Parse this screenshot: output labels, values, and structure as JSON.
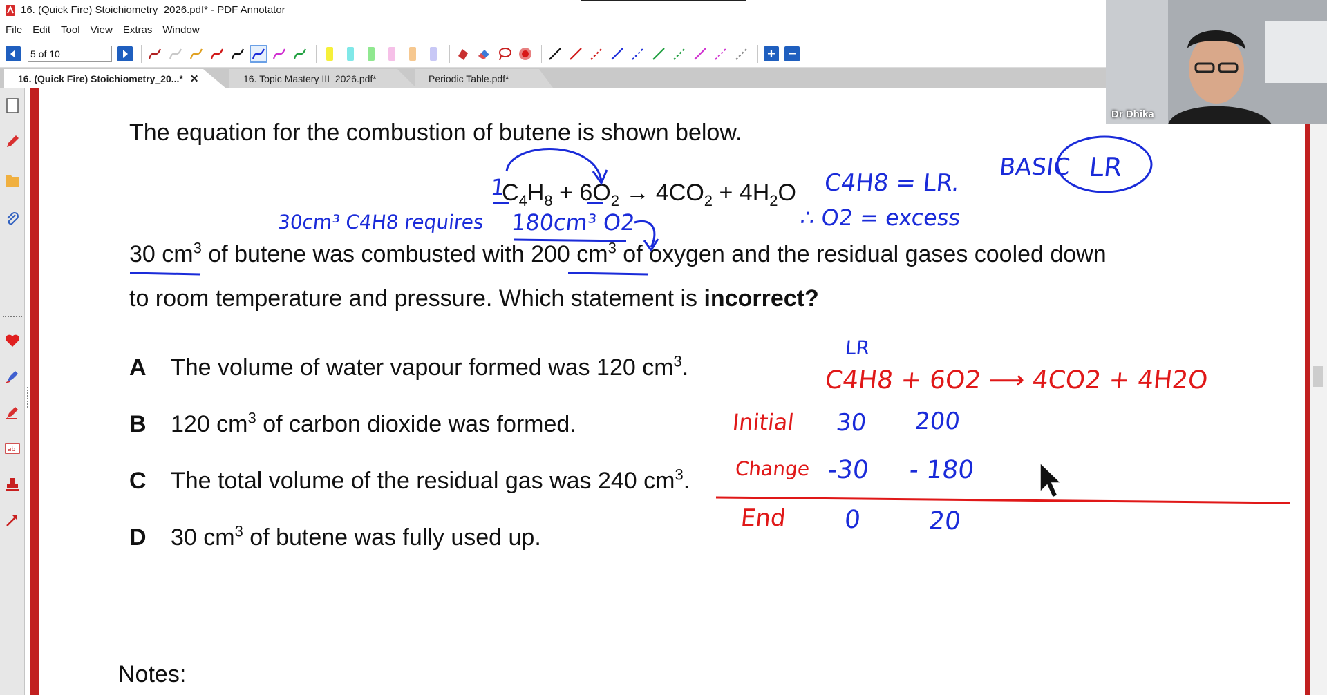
{
  "window": {
    "title": "16. (Quick Fire) Stoichiometry_2026.pdf* - PDF Annotator"
  },
  "menu": [
    "File",
    "Edit",
    "Tool",
    "View",
    "Extras",
    "Window"
  ],
  "toolbar": {
    "page_value": "5 of 10",
    "pen_colors": [
      "#b02020",
      "#c8c8c8",
      "#e0a020",
      "#d01818",
      "#111111",
      "#1a2bd9",
      "#d030d0",
      "#20a040"
    ],
    "highlighter_colors": [
      "#f6f03a",
      "#80e8e8",
      "#90e890",
      "#f6c0e8",
      "#f6c890",
      "#c8c8f6"
    ],
    "line_colors": [
      "#111111",
      "#d01818",
      "#d01818",
      "#1a2bd9",
      "#1a2bd9",
      "#20a040",
      "#20a040",
      "#d030d0",
      "#d030d0",
      "#888888"
    ]
  },
  "tabs": [
    {
      "label": "16. (Quick Fire) Stoichiometry_20...*",
      "active": true,
      "close": "✕"
    },
    {
      "label": "16. Topic Mastery III_2026.pdf*",
      "active": false
    },
    {
      "label": "Periodic Table.pdf*",
      "active": false
    }
  ],
  "document": {
    "intro": "The equation for the combustion of butene is shown below.",
    "equation": {
      "reactant1": "C",
      "s4": "4",
      "h": "H",
      "s8": "8",
      "plus1": " + 6O",
      "s2a": "2",
      "arrow": " → 4CO",
      "s2b": "2",
      "plus2": " + 4H",
      "s2c": "2",
      "o": "O"
    },
    "body1": {
      "a": "30 cm",
      "sup": "3",
      "b": " of butene was combusted with 200 cm",
      "sup2": "3",
      "c": " of oxygen and the residual gases cooled down"
    },
    "body2": {
      "a": "to room temperature and pressure. Which statement is ",
      "bold": "incorrect?"
    },
    "options": [
      {
        "letter": "A",
        "text": "The volume of water vapour formed was 120 cm",
        "sup": "3",
        "end": "."
      },
      {
        "letter": "B",
        "text": "120 cm",
        "sup": "3",
        "end": " of carbon dioxide was formed."
      },
      {
        "letter": "C",
        "text": "The total volume of the residual gas was 240 cm",
        "sup": "3",
        "end": "."
      },
      {
        "letter": "D",
        "text": "30 cm",
        "sup": "3",
        "end": " of butene was fully used up."
      }
    ],
    "notes": "Notes:"
  },
  "annotations": {
    "one": "1",
    "requires": "30cm³ C4H8  requires",
    "o2_needed": "180cm³ O2",
    "lr_line": "C4H8 = LR.",
    "excess_line": "∴ O2 = excess",
    "basic": "BASIC",
    "lr_circle": "LR",
    "lr_label": "LR",
    "table_eq": "C4H8 + 6O2 ⟶ 4CO2 + 4H2O",
    "rows": [
      {
        "label": "Initial",
        "c4h8": "30",
        "o2": "200"
      },
      {
        "label": "Change",
        "c4h8": "-30",
        "o2": "- 180"
      },
      {
        "label": "End",
        "c4h8": "0",
        "o2": "20"
      }
    ]
  },
  "webcam": {
    "name": "Dr Dhika"
  }
}
